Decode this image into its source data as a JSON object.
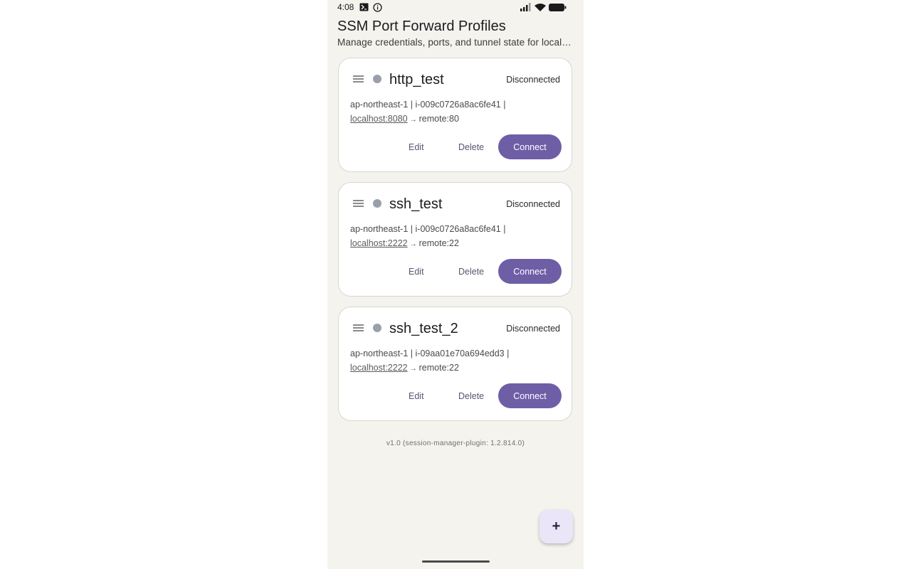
{
  "status_bar": {
    "time": "4:08"
  },
  "header": {
    "title": "SSM Port Forward Profiles",
    "subtitle": "Manage credentials, ports, and tunnel state for local forwarding"
  },
  "profiles": [
    {
      "name": "http_test",
      "state": "Disconnected",
      "region": "ap-northeast-1",
      "instance": "i-009c0726a8ac6fe41",
      "local": "localhost:8080",
      "remote": "remote:80",
      "edit_label": "Edit",
      "delete_label": "Delete",
      "connect_label": "Connect"
    },
    {
      "name": "ssh_test",
      "state": "Disconnected",
      "region": "ap-northeast-1",
      "instance": "i-009c0726a8ac6fe41",
      "local": "localhost:2222",
      "remote": "remote:22",
      "edit_label": "Edit",
      "delete_label": "Delete",
      "connect_label": "Connect"
    },
    {
      "name": "ssh_test_2",
      "state": "Disconnected",
      "region": "ap-northeast-1",
      "instance": "i-09aa01e70a694edd3",
      "local": "localhost:2222",
      "remote": "remote:22",
      "edit_label": "Edit",
      "delete_label": "Delete",
      "connect_label": "Connect"
    }
  ],
  "separator": " | ",
  "arrow": "→",
  "footer": {
    "version": "v1.0 (session-manager-plugin: 1.2.814.0)"
  },
  "fab": {
    "label": "+"
  },
  "colors": {
    "accent": "#6e5ea6",
    "status_dot": "#9aa0aa",
    "background": "#f5f3ee",
    "fab_bg": "#ebe5f8"
  }
}
